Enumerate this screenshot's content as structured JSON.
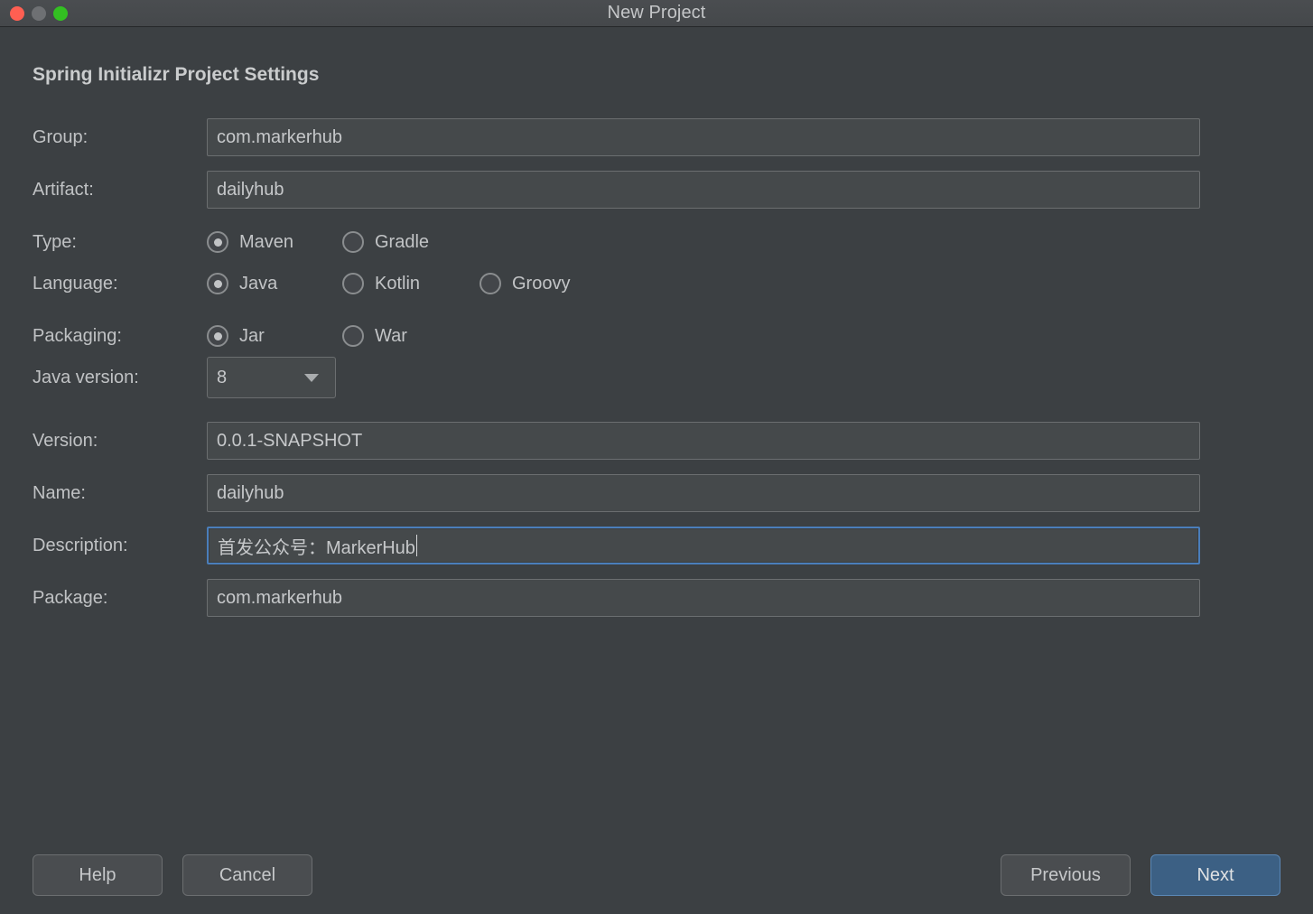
{
  "window": {
    "title": "New Project",
    "traffic_lights": [
      {
        "name": "close",
        "color": "#ff5f52"
      },
      {
        "name": "minimize",
        "color": "#6e7073"
      },
      {
        "name": "maximize",
        "color": "#33c022"
      }
    ]
  },
  "heading": "Spring Initializr Project Settings",
  "fields": {
    "group": {
      "label": "Group:",
      "value": "com.markerhub"
    },
    "artifact": {
      "label": "Artifact:",
      "value": "dailyhub"
    },
    "version": {
      "label": "Version:",
      "value": "0.0.1-SNAPSHOT"
    },
    "name": {
      "label": "Name:",
      "value": "dailyhub"
    },
    "description": {
      "label": "Description:",
      "value": "首发公众号：MarkerHub",
      "focused": true
    },
    "package": {
      "label": "Package:",
      "value": "com.markerhub"
    }
  },
  "type": {
    "label": "Type:",
    "options": [
      {
        "label": "Maven",
        "selected": true
      },
      {
        "label": "Gradle",
        "selected": false
      }
    ]
  },
  "language": {
    "label": "Language:",
    "options": [
      {
        "label": "Java",
        "selected": true
      },
      {
        "label": "Kotlin",
        "selected": false
      },
      {
        "label": "Groovy",
        "selected": false
      }
    ]
  },
  "packaging": {
    "label": "Packaging:",
    "options": [
      {
        "label": "Jar",
        "selected": true
      },
      {
        "label": "War",
        "selected": false
      }
    ]
  },
  "java_version": {
    "label": "Java version:",
    "value": "8",
    "dropdown_icon": "chevron-down-icon"
  },
  "buttons": {
    "help": "Help",
    "cancel": "Cancel",
    "previous": "Previous",
    "next": "Next"
  },
  "colors": {
    "dialog_background": "#3c4043",
    "field_background": "#45494b",
    "field_border": "#6b6e70",
    "focus_border": "#4a7ebb",
    "primary_button": "#3c6084",
    "text": "#c6c8ca"
  }
}
